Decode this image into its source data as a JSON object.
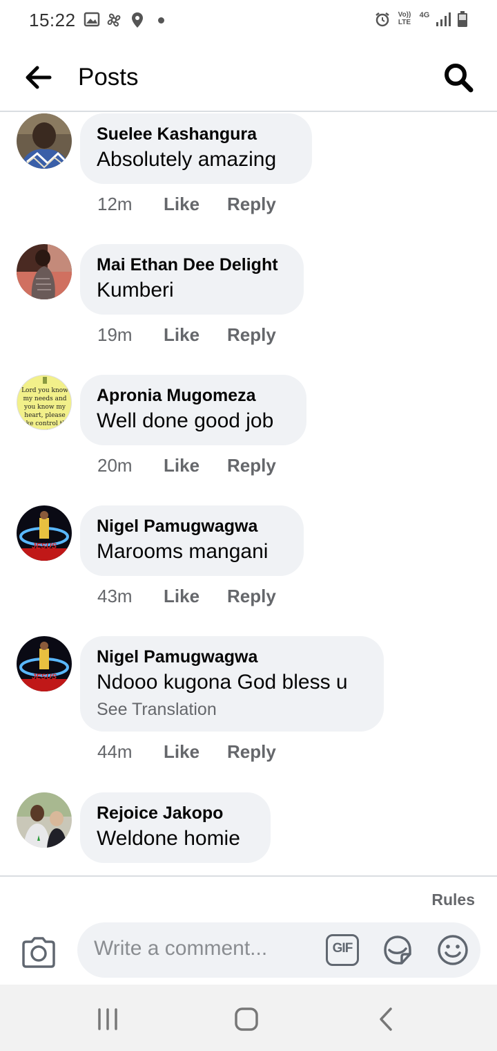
{
  "status_bar": {
    "time": "15:22",
    "left_icons": [
      "image-icon",
      "pinwheel-icon",
      "location-icon",
      "dot-icon"
    ],
    "right_icons": [
      "alarm-icon",
      "volte-icon",
      "4g-icon",
      "signal-icon",
      "battery-icon"
    ],
    "volte_label": "Vo)) LTE",
    "network_label": "4G"
  },
  "header": {
    "title": "Posts"
  },
  "comments": [
    {
      "author": "Suelee Kashangura",
      "text": "Absolutely amazing",
      "time": "12m",
      "like": "Like",
      "reply": "Reply"
    },
    {
      "author": "Mai Ethan Dee Delight",
      "text": "Kumberi",
      "time": "19m",
      "like": "Like",
      "reply": "Reply"
    },
    {
      "author": "Apronia Mugomeza",
      "text": "Well done good job",
      "time": "20m",
      "like": "Like",
      "reply": "Reply",
      "avatar_text": "Lord you know my needs and you know my heart, please take control the situation"
    },
    {
      "author": "Nigel Pamugwagwa",
      "text": "Marooms mangani",
      "time": "43m",
      "like": "Like",
      "reply": "Reply",
      "avatar_text": "JESUS"
    },
    {
      "author": "Nigel Pamugwagwa",
      "text": "Ndooo kugona God bless u",
      "translate": "See Translation",
      "time": "44m",
      "like": "Like",
      "reply": "Reply",
      "avatar_text": "JESUS"
    },
    {
      "author": "Rejoice Jakopo",
      "text": "Weldone homie"
    }
  ],
  "composer": {
    "rules": "Rules",
    "placeholder": "Write a comment...",
    "gif_label": "GIF"
  },
  "colors": {
    "bubble": "#f0f2f5",
    "secondary_text": "#65676b",
    "primary_text": "#050505",
    "divider": "#dadde1"
  }
}
